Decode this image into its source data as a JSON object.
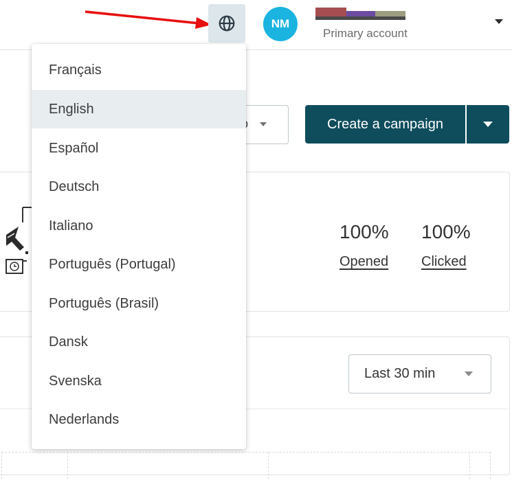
{
  "header": {
    "avatar_initials": "NM",
    "account_label": "Primary account",
    "account_name_colors": [
      "#a44e51",
      "#6c4ca0",
      "#9d9d80"
    ],
    "icons": {
      "language": "globe-icon",
      "menu": "chevron-down-icon"
    }
  },
  "annotation": {
    "arrow_color": "#e81010"
  },
  "toolbar": {
    "secondary_partial_label": "p",
    "create_campaign_label": "Create a campaign",
    "accent_color": "#0f4d5c"
  },
  "stats": [
    {
      "value": "100%",
      "label": "Opened"
    },
    {
      "value": "100%",
      "label": "Clicked"
    }
  ],
  "chart": {
    "range_label": "Last 30 min"
  },
  "language_menu": {
    "selected": "English",
    "items": [
      "Français",
      "English",
      "Español",
      "Deutsch",
      "Italiano",
      "Português (Portugal)",
      "Português (Brasil)",
      "Dansk",
      "Svenska",
      "Nederlands"
    ]
  }
}
